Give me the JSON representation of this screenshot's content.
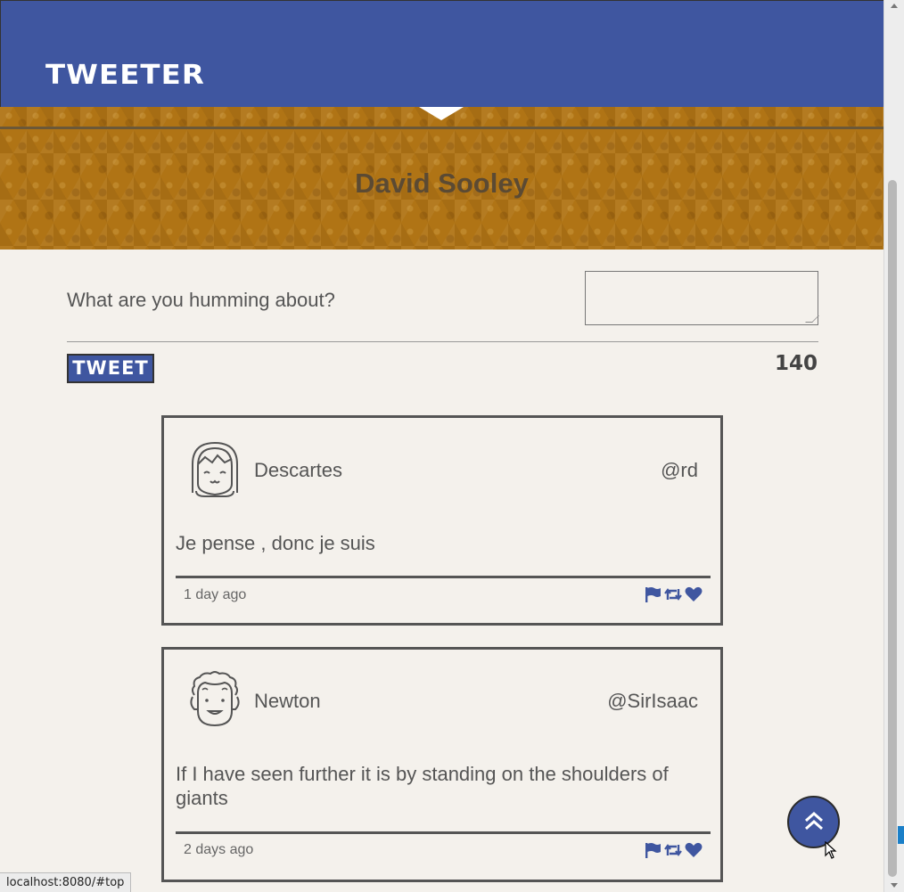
{
  "nav": {
    "brand": "TWEETER"
  },
  "profile": {
    "name": "David Sooley"
  },
  "compose": {
    "prompt": "What are you humming about?",
    "value": "",
    "button_label": "TWEET",
    "char_count": "140"
  },
  "tweets": [
    {
      "avatar_icon": "girl-face-icon",
      "name": "Descartes",
      "handle": "@rd",
      "text": "Je pense , donc je suis",
      "time": "1 day ago"
    },
    {
      "avatar_icon": "curly-hair-face-icon",
      "name": "Newton",
      "handle": "@SirIsaac",
      "text": "If I have seen further it is by standing on the shoulders of giants",
      "time": "2 days ago"
    }
  ],
  "actions": [
    "flag-icon",
    "retweet-icon",
    "heart-icon"
  ],
  "status_url": "localhost:8080/#top",
  "colors": {
    "primary": "#3f56a0",
    "banner": "#b07415",
    "background": "#f4f1ec",
    "text": "#555555"
  }
}
